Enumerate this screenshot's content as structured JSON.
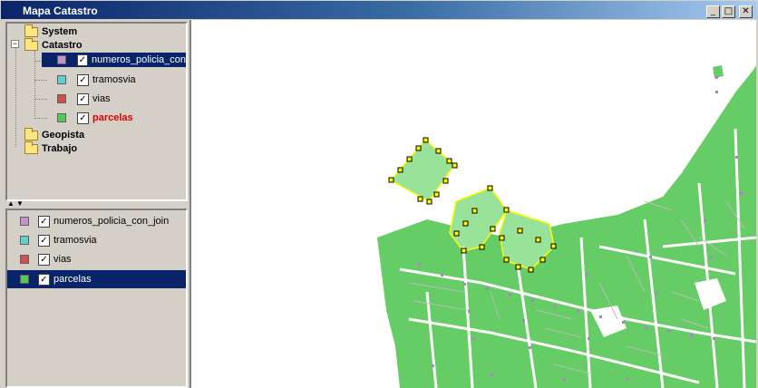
{
  "window": {
    "title": "Mapa Catastro"
  },
  "controls": {
    "minimize": "_",
    "maximize": "□",
    "close": "✕"
  },
  "tree": {
    "folders": [
      "System",
      "Catastro",
      "Geopista",
      "Trabajo"
    ],
    "layers": [
      {
        "label": "numeros_policia_con",
        "swatch": "#c792cc",
        "checked": true,
        "selected": true,
        "highlight": false
      },
      {
        "label": "tramosvia",
        "swatch": "#5fcfcf",
        "checked": true,
        "selected": false,
        "highlight": false
      },
      {
        "label": "vias",
        "swatch": "#d05050",
        "checked": true,
        "selected": false,
        "highlight": false
      },
      {
        "label": "parcelas",
        "swatch": "#55c855",
        "checked": true,
        "selected": false,
        "highlight": true
      }
    ]
  },
  "list": {
    "layers": [
      {
        "label": "numeros_policia_con_join",
        "swatch": "#c792cc",
        "checked": true,
        "selected": false
      },
      {
        "label": "tramosvia",
        "swatch": "#5fcfcf",
        "checked": true,
        "selected": false
      },
      {
        "label": "vias",
        "swatch": "#d05050",
        "checked": true,
        "selected": false
      },
      {
        "label": "parcelas",
        "swatch": "#55c855",
        "checked": true,
        "selected": true
      }
    ]
  },
  "map": {
    "parcel_color": "#66cc66",
    "selected_color": "#99e299",
    "street_color": "#ffffff",
    "point_color": "#b080c8",
    "highlight_color": "#ffff00"
  }
}
